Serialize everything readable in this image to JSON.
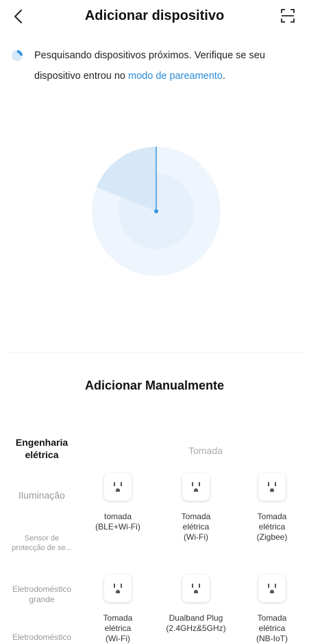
{
  "header": {
    "title": "Adicionar dispositivo",
    "back_icon": "chevron-left-icon",
    "scan_icon": "scan-frame-icon"
  },
  "notice": {
    "text_before": "Pesquisando dispositivos próximos. Verifique se seu dispositivo entrou no ",
    "link": "modo de pareamento",
    "text_after": "."
  },
  "manual": {
    "title": "Adicionar Manualmente"
  },
  "categories": [
    {
      "label_line1": "Engenharia",
      "label_line2": "elétrica",
      "active": true
    },
    {
      "label_line1": "Iluminação",
      "label_line2": "",
      "active": false
    },
    {
      "label_line1": "Sensor de",
      "label_line2": "protecção de se...",
      "active": false
    },
    {
      "label_line1": "Eletrodoméstico",
      "label_line2": "grande",
      "active": false
    },
    {
      "label_line1": "Eletrodoméstico",
      "label_line2": "",
      "active": false
    }
  ],
  "section": {
    "title": "Tomada"
  },
  "devices": [
    {
      "line1": "tomada",
      "line2": "(BLE+Wi-Fi)",
      "line3": ""
    },
    {
      "line1": "Tomada",
      "line2": "elétrica",
      "line3": "(Wi-Fi)"
    },
    {
      "line1": "Tomada",
      "line2": "elétrica",
      "line3": "(Zigbee)"
    },
    {
      "line1": "Tomada",
      "line2": "elétrica",
      "line3": "(Wi-Fi)"
    },
    {
      "line1": "Dualband Plug",
      "line2": "(2.4GHz&5GHz)",
      "line3": ""
    },
    {
      "line1": "Tomada",
      "line2": "elétrica",
      "line3": "(NB-IoT)"
    }
  ],
  "colors": {
    "accent": "#2a8bd8",
    "radar_light": "#eaf3fb",
    "radar_mid": "#d9e9f7"
  }
}
